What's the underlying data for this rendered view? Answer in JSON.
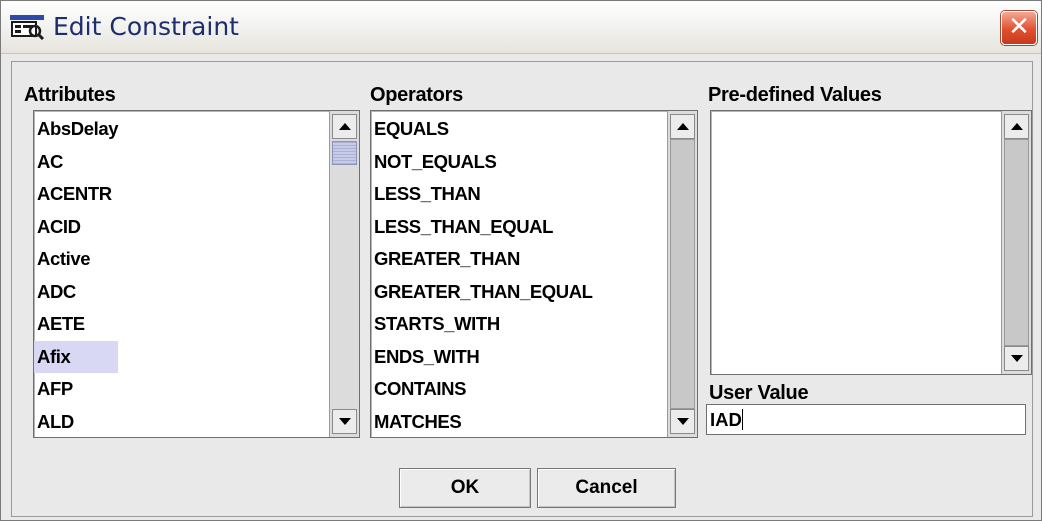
{
  "window": {
    "title": "Edit Constraint",
    "close_glyph": "✕"
  },
  "attributes": {
    "label": "Attributes",
    "items": [
      "AbsDelay",
      "AC",
      "ACENTR",
      "ACID",
      "Active",
      "ADC",
      "AETE",
      "Afix",
      "AFP",
      "ALD"
    ],
    "selected": "Afix"
  },
  "operators": {
    "label": "Operators",
    "items": [
      "EQUALS",
      "NOT_EQUALS",
      "LESS_THAN",
      "LESS_THAN_EQUAL",
      "GREATER_THAN",
      "GREATER_THAN_EQUAL",
      "STARTS_WITH",
      "ENDS_WITH",
      "CONTAINS",
      "MATCHES"
    ]
  },
  "predefined": {
    "label": "Pre-defined Values",
    "items": []
  },
  "user_value": {
    "label": "User Value",
    "value": "IAD"
  },
  "buttons": {
    "ok": "OK",
    "cancel": "Cancel"
  },
  "icons": {
    "app": "window-app-icon",
    "close": "close-icon"
  },
  "colors": {
    "selection": "#d8d8f4",
    "title_text": "#1e2d6e",
    "close_button": "#e0502f",
    "scroll_thumb": "#c7cbe6"
  }
}
